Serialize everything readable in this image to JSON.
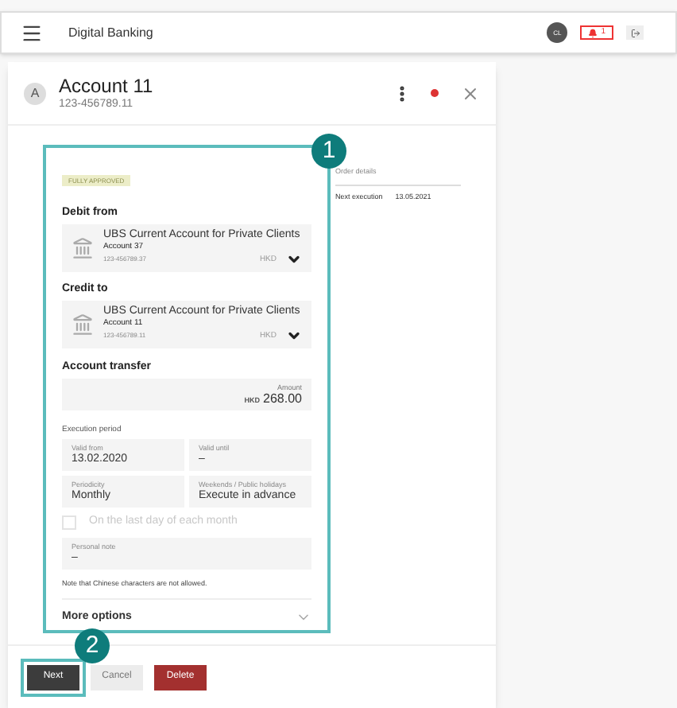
{
  "header": {
    "title": "Digital Banking",
    "avatar": "CL",
    "alert_count": "1"
  },
  "panel": {
    "avatar": "A",
    "title": "Account 11",
    "subtitle": "123-456789.11"
  },
  "callouts": [
    "1",
    "2"
  ],
  "form": {
    "status": "FULLY APPROVED",
    "debit": {
      "label": "Debit from",
      "bank": "UBS Current Account for Private Clients",
      "account": "Account 37",
      "number": "123-456789.37",
      "currency": "HKD"
    },
    "credit": {
      "label": "Credit to",
      "bank": "UBS Current Account for Private Clients",
      "account": "Account 11",
      "number": "123-456789.11",
      "currency": "HKD"
    },
    "transfer": {
      "label": "Account transfer",
      "amount_label": "Amount",
      "currency": "HKD",
      "amount": "268.00"
    },
    "period_label": "Execution period",
    "fields": [
      {
        "label": "Valid from",
        "value": "13.02.2020"
      },
      {
        "label": "Valid until",
        "value": "–"
      },
      {
        "label": "Periodicity",
        "value": "Monthly"
      },
      {
        "label": "Weekends / Public holidays",
        "value": "Execute in advance"
      }
    ],
    "last_day": {
      "label": "On the last day of each month",
      "checked": false,
      "disabled": true
    },
    "note": {
      "label": "Personal note",
      "value": "–"
    },
    "hint": "Note that Chinese characters are not allowed.",
    "more": {
      "label": "More options",
      "expanded": false
    }
  },
  "order": {
    "title": "Order details",
    "label": "Next execution",
    "value": "13.05.2021"
  },
  "buttons": [
    {
      "label": "Next",
      "kind": "primary"
    },
    {
      "label": "Cancel",
      "kind": "secondary"
    },
    {
      "label": "Delete",
      "kind": "danger"
    }
  ]
}
